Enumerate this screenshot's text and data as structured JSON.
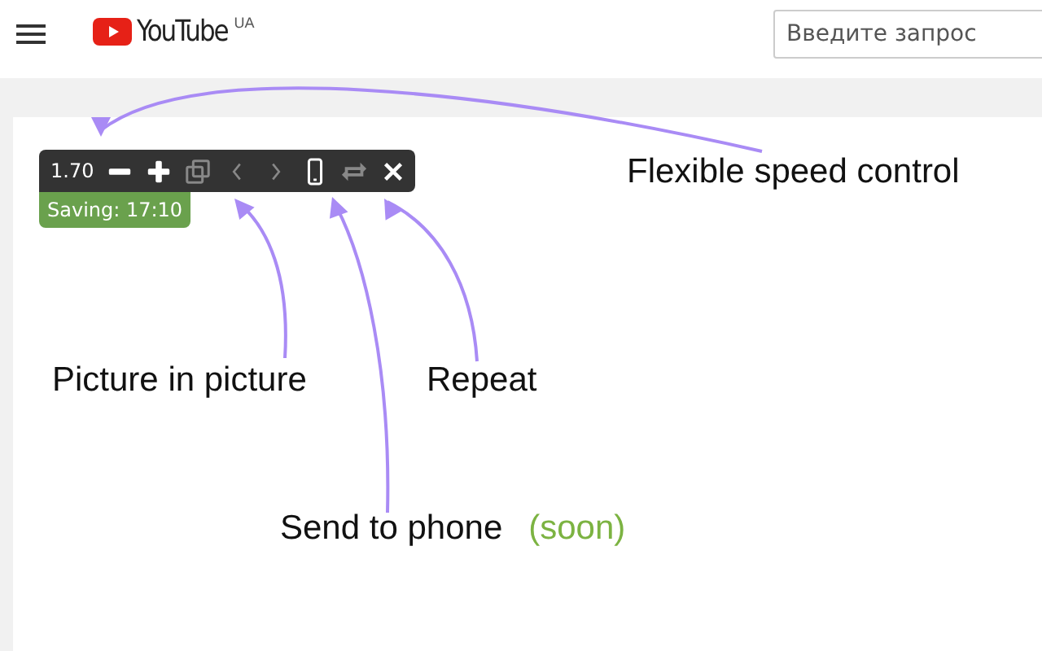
{
  "header": {
    "logo": "YouTube",
    "region": "UA",
    "search": {
      "placeholder": "Введите запрос"
    }
  },
  "toolbar": {
    "speed": "1.70",
    "buttons": [
      {
        "kind": "minus",
        "disabled": false
      },
      {
        "kind": "plus",
        "disabled": false
      },
      {
        "kind": "pip",
        "disabled": true
      },
      {
        "kind": "prev",
        "disabled": true
      },
      {
        "kind": "next",
        "disabled": true
      },
      {
        "kind": "phone",
        "disabled": false
      },
      {
        "kind": "repeat",
        "disabled": true
      },
      {
        "kind": "close",
        "disabled": false
      }
    ],
    "saving": "Saving: 17:10"
  },
  "annotations": [
    {
      "label": "Flexible speed control",
      "kind": "speed"
    },
    {
      "label": "Picture in picture",
      "kind": "pip"
    },
    {
      "label": "Repeat",
      "kind": "repeat"
    },
    {
      "label": "Send to phone",
      "note": "(soon)",
      "color": "#7cb342",
      "kind": "phone"
    }
  ]
}
